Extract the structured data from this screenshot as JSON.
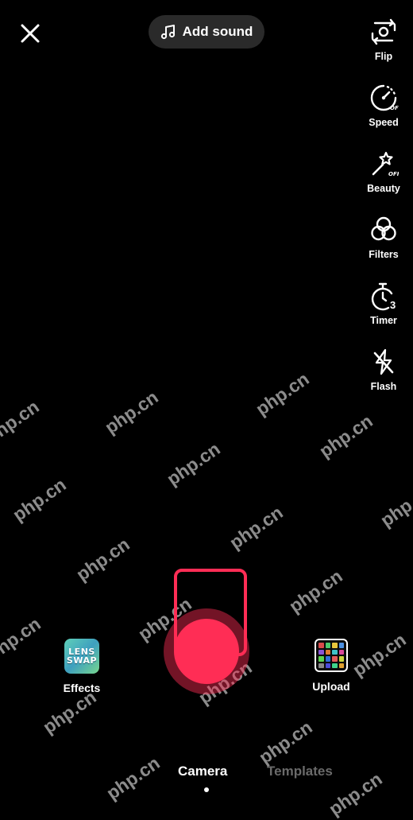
{
  "top_bar": {
    "close_icon": "close-icon",
    "add_sound_label": "Add sound",
    "add_sound_icon": "music-note-icon"
  },
  "side_tools": [
    {
      "label": "Flip",
      "icon": "flip-camera-icon"
    },
    {
      "label": "Speed",
      "icon": "speed-gauge-icon",
      "badge": "OFF"
    },
    {
      "label": "Beauty",
      "icon": "magic-wand-icon",
      "badge": "OFF"
    },
    {
      "label": "Filters",
      "icon": "filters-icon"
    },
    {
      "label": "Timer",
      "icon": "timer-icon",
      "badge": "3"
    },
    {
      "label": "Flash",
      "icon": "flash-off-icon"
    }
  ],
  "effects": {
    "label": "Effects",
    "thumb_line1": "LENS",
    "thumb_line2": "SWAP"
  },
  "upload": {
    "label": "Upload"
  },
  "record": {
    "accent_color": "#ff2d55"
  },
  "modes": {
    "items": [
      "Camera",
      "Templates"
    ],
    "selected": "Camera"
  },
  "watermark": {
    "text": "php.cn"
  }
}
